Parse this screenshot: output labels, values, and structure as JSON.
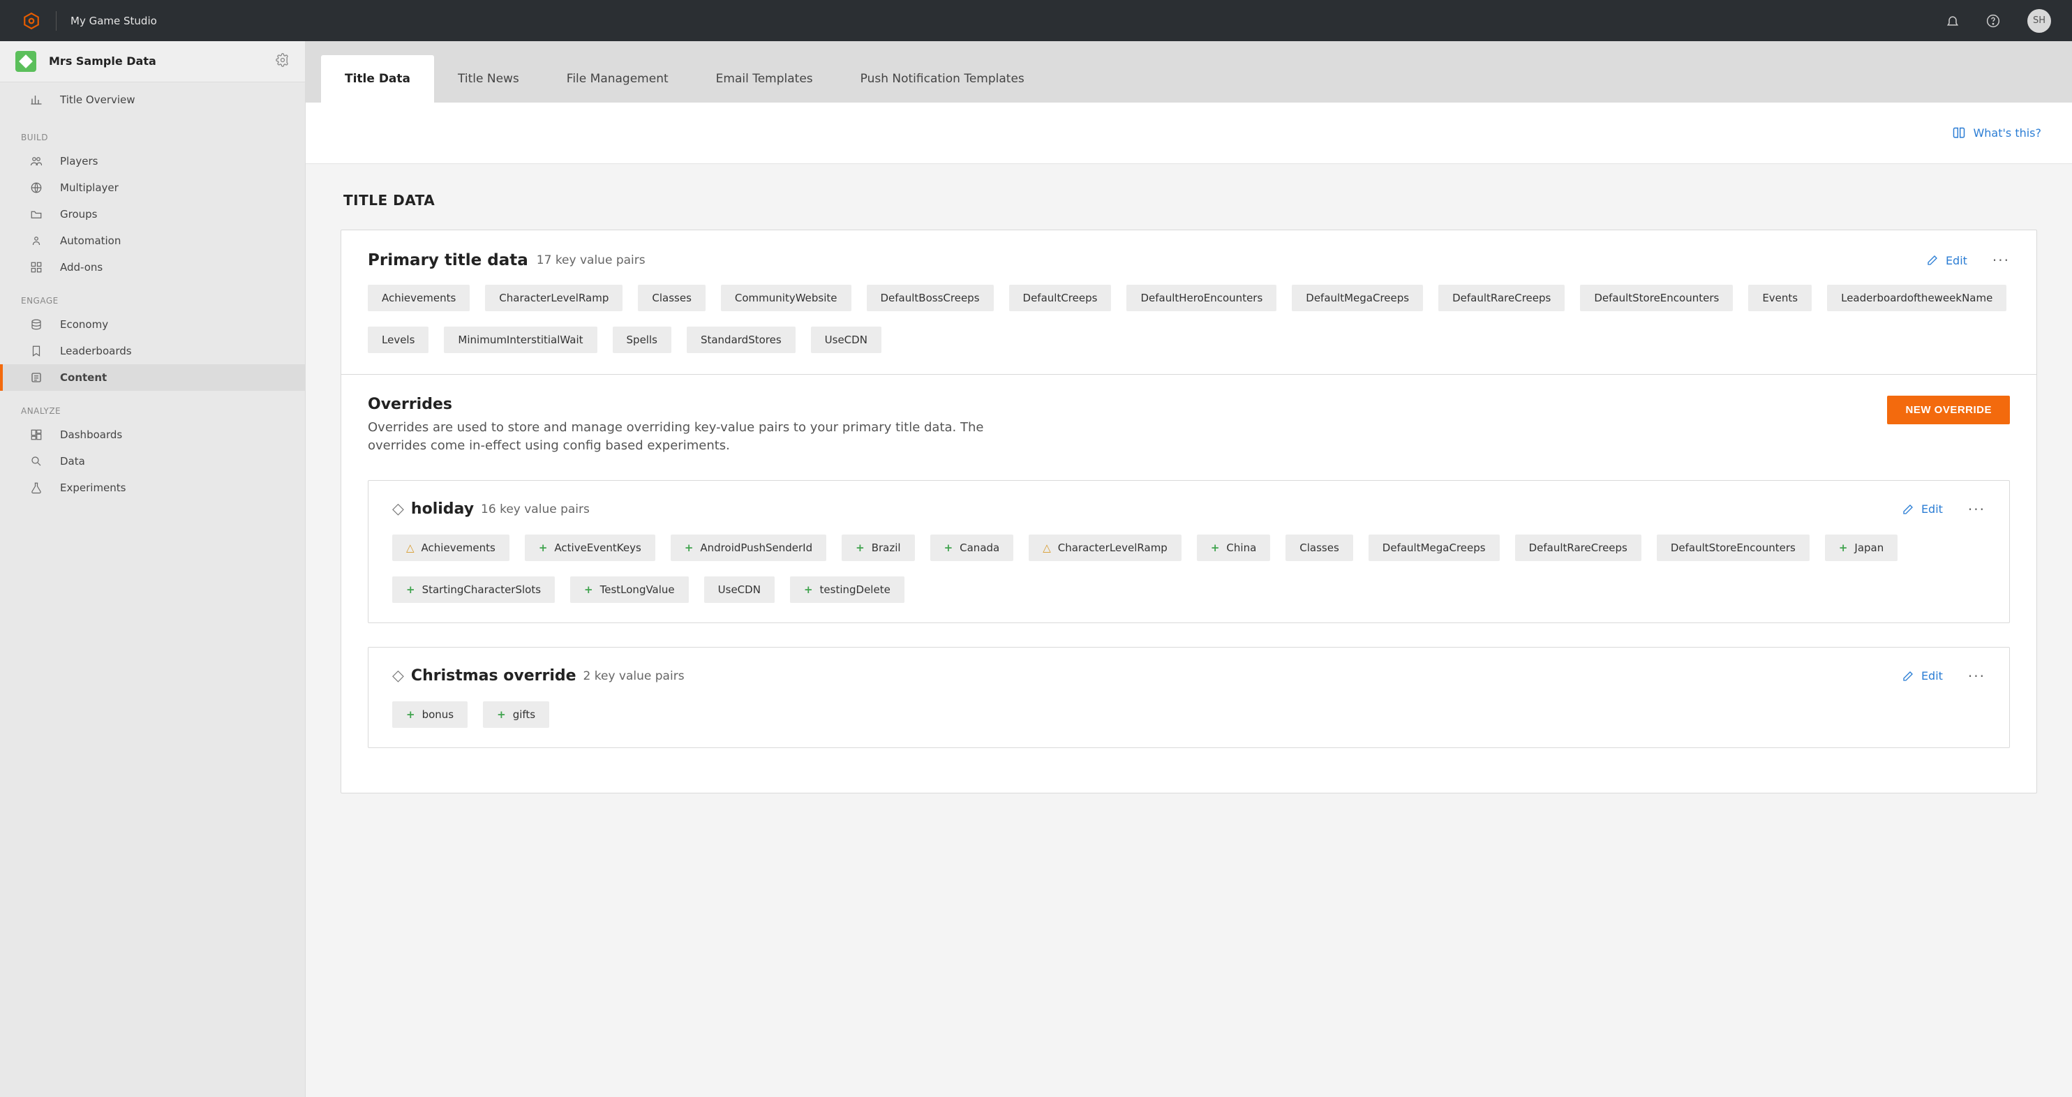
{
  "topbar": {
    "studio": "My Game Studio",
    "avatar": "SH"
  },
  "sidebar": {
    "title_name": "Mrs Sample Data",
    "overview": "Title Overview",
    "groups": {
      "build": {
        "label": "BUILD",
        "items": [
          "Players",
          "Multiplayer",
          "Groups",
          "Automation",
          "Add-ons"
        ]
      },
      "engage": {
        "label": "ENGAGE",
        "items": [
          "Economy",
          "Leaderboards",
          "Content"
        ]
      },
      "analyze": {
        "label": "ANALYZE",
        "items": [
          "Dashboards",
          "Data",
          "Experiments"
        ]
      }
    }
  },
  "tabs": {
    "items": [
      "Title Data",
      "Title News",
      "File Management",
      "Email Templates",
      "Push Notification Templates"
    ],
    "active": 0
  },
  "subhead": {
    "whats_this": "What's this?"
  },
  "main": {
    "heading": "TITLE DATA",
    "edit_label": "Edit",
    "primary": {
      "title": "Primary title data",
      "count_label": "17 key value pairs",
      "chips": [
        {
          "label": "Achievements"
        },
        {
          "label": "CharacterLevelRamp"
        },
        {
          "label": "Classes"
        },
        {
          "label": "CommunityWebsite"
        },
        {
          "label": "DefaultBossCreeps"
        },
        {
          "label": "DefaultCreeps"
        },
        {
          "label": "DefaultHeroEncounters"
        },
        {
          "label": "DefaultMegaCreeps"
        },
        {
          "label": "DefaultRareCreeps"
        },
        {
          "label": "DefaultStoreEncounters"
        },
        {
          "label": "Events"
        },
        {
          "label": "LeaderboardoftheweekName"
        },
        {
          "label": "Levels"
        },
        {
          "label": "MinimumInterstitialWait"
        },
        {
          "label": "Spells"
        },
        {
          "label": "StandardStores"
        },
        {
          "label": "UseCDN"
        }
      ]
    },
    "overrides": {
      "title": "Overrides",
      "description": "Overrides are used to store and manage overriding key-value pairs to your primary title data. The overrides come in-effect using config based experiments.",
      "new_button": "NEW OVERRIDE",
      "items": [
        {
          "name": "holiday",
          "count_label": "16 key value pairs",
          "chips": [
            {
              "label": "Achievements",
              "mark": "warn"
            },
            {
              "label": "ActiveEventKeys",
              "mark": "plus"
            },
            {
              "label": "AndroidPushSenderId",
              "mark": "plus"
            },
            {
              "label": "Brazil",
              "mark": "plus"
            },
            {
              "label": "Canada",
              "mark": "plus"
            },
            {
              "label": "CharacterLevelRamp",
              "mark": "warn"
            },
            {
              "label": "China",
              "mark": "plus"
            },
            {
              "label": "Classes"
            },
            {
              "label": "DefaultMegaCreeps"
            },
            {
              "label": "DefaultRareCreeps"
            },
            {
              "label": "DefaultStoreEncounters"
            },
            {
              "label": "Japan",
              "mark": "plus"
            },
            {
              "label": "StartingCharacterSlots",
              "mark": "plus"
            },
            {
              "label": "TestLongValue",
              "mark": "plus"
            },
            {
              "label": "UseCDN"
            },
            {
              "label": "testingDelete",
              "mark": "plus"
            }
          ]
        },
        {
          "name": "Christmas override",
          "count_label": "2 key value pairs",
          "chips": [
            {
              "label": "bonus",
              "mark": "plus"
            },
            {
              "label": "gifts",
              "mark": "plus"
            }
          ]
        }
      ]
    }
  }
}
